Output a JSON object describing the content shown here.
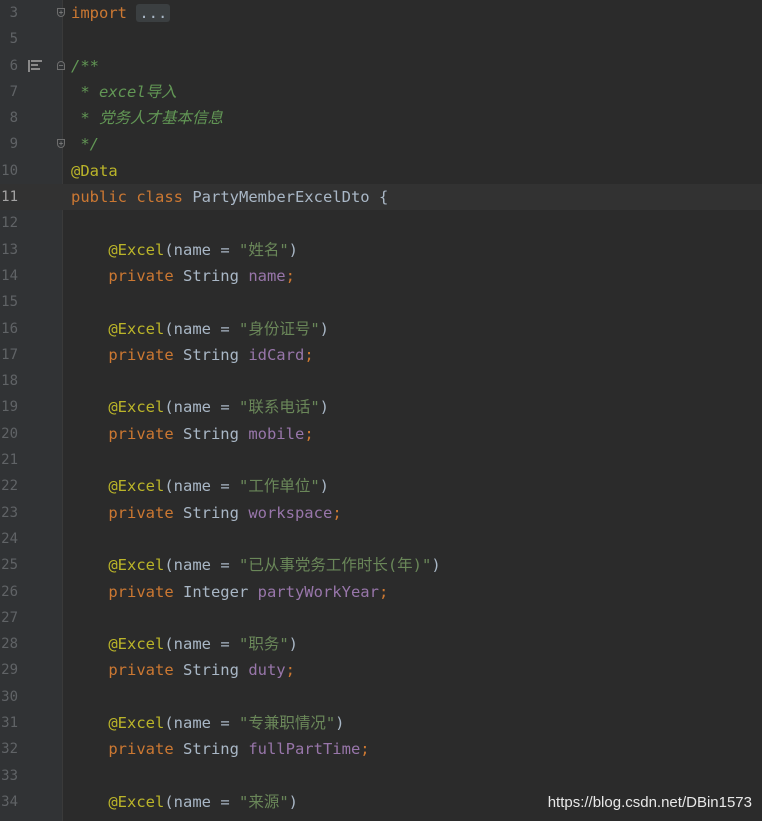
{
  "editor": {
    "lines": [
      {
        "n": "3",
        "tokens": [
          {
            "t": "import ",
            "c": "kw"
          },
          {
            "t": "...",
            "c": "fold"
          }
        ]
      },
      {
        "n": "5",
        "tokens": []
      },
      {
        "n": "6",
        "tokens": [
          {
            "t": "/**",
            "c": "cmt"
          }
        ]
      },
      {
        "n": "7",
        "tokens": [
          {
            "t": " * excel导入",
            "c": "cmt"
          }
        ]
      },
      {
        "n": "8",
        "tokens": [
          {
            "t": " * 党务人才基本信息",
            "c": "cmt"
          }
        ]
      },
      {
        "n": "9",
        "tokens": [
          {
            "t": " */",
            "c": "cmt"
          }
        ]
      },
      {
        "n": "10",
        "tokens": [
          {
            "t": "@Data",
            "c": "ann"
          }
        ]
      },
      {
        "n": "11",
        "tokens": [
          {
            "t": "public class ",
            "c": "kw"
          },
          {
            "t": "PartyMemberExcelDto {",
            "c": ""
          }
        ]
      },
      {
        "n": "12",
        "tokens": []
      },
      {
        "n": "13",
        "tokens": [
          {
            "t": "    @Excel",
            "c": "ann"
          },
          {
            "t": "(name = ",
            "c": ""
          },
          {
            "t": "\"姓名\"",
            "c": "str"
          },
          {
            "t": ")",
            "c": ""
          }
        ]
      },
      {
        "n": "14",
        "tokens": [
          {
            "t": "    private ",
            "c": "kw"
          },
          {
            "t": "String ",
            "c": ""
          },
          {
            "t": "name",
            "c": "fld"
          },
          {
            "t": ";",
            "c": "kw"
          }
        ]
      },
      {
        "n": "15",
        "tokens": []
      },
      {
        "n": "16",
        "tokens": [
          {
            "t": "    @Excel",
            "c": "ann"
          },
          {
            "t": "(name = ",
            "c": ""
          },
          {
            "t": "\"身份证号\"",
            "c": "str"
          },
          {
            "t": ")",
            "c": ""
          }
        ]
      },
      {
        "n": "17",
        "tokens": [
          {
            "t": "    private ",
            "c": "kw"
          },
          {
            "t": "String ",
            "c": ""
          },
          {
            "t": "idCard",
            "c": "fld"
          },
          {
            "t": ";",
            "c": "kw"
          }
        ]
      },
      {
        "n": "18",
        "tokens": []
      },
      {
        "n": "19",
        "tokens": [
          {
            "t": "    @Excel",
            "c": "ann"
          },
          {
            "t": "(name = ",
            "c": ""
          },
          {
            "t": "\"联系电话\"",
            "c": "str"
          },
          {
            "t": ")",
            "c": ""
          }
        ]
      },
      {
        "n": "20",
        "tokens": [
          {
            "t": "    private ",
            "c": "kw"
          },
          {
            "t": "String ",
            "c": ""
          },
          {
            "t": "mobile",
            "c": "fld"
          },
          {
            "t": ";",
            "c": "kw"
          }
        ]
      },
      {
        "n": "21",
        "tokens": []
      },
      {
        "n": "22",
        "tokens": [
          {
            "t": "    @Excel",
            "c": "ann"
          },
          {
            "t": "(name = ",
            "c": ""
          },
          {
            "t": "\"工作单位\"",
            "c": "str"
          },
          {
            "t": ")",
            "c": ""
          }
        ]
      },
      {
        "n": "23",
        "tokens": [
          {
            "t": "    private ",
            "c": "kw"
          },
          {
            "t": "String ",
            "c": ""
          },
          {
            "t": "workspace",
            "c": "fld"
          },
          {
            "t": ";",
            "c": "kw"
          }
        ]
      },
      {
        "n": "24",
        "tokens": []
      },
      {
        "n": "25",
        "tokens": [
          {
            "t": "    @Excel",
            "c": "ann"
          },
          {
            "t": "(name = ",
            "c": ""
          },
          {
            "t": "\"已从事党务工作时长(年)\"",
            "c": "str"
          },
          {
            "t": ")",
            "c": ""
          }
        ]
      },
      {
        "n": "26",
        "tokens": [
          {
            "t": "    private ",
            "c": "kw"
          },
          {
            "t": "Integer ",
            "c": ""
          },
          {
            "t": "partyWorkYear",
            "c": "fld"
          },
          {
            "t": ";",
            "c": "kw"
          }
        ]
      },
      {
        "n": "27",
        "tokens": []
      },
      {
        "n": "28",
        "tokens": [
          {
            "t": "    @Excel",
            "c": "ann"
          },
          {
            "t": "(name = ",
            "c": ""
          },
          {
            "t": "\"职务\"",
            "c": "str"
          },
          {
            "t": ")",
            "c": ""
          }
        ]
      },
      {
        "n": "29",
        "tokens": [
          {
            "t": "    private ",
            "c": "kw"
          },
          {
            "t": "String ",
            "c": ""
          },
          {
            "t": "duty",
            "c": "fld"
          },
          {
            "t": ";",
            "c": "kw"
          }
        ]
      },
      {
        "n": "30",
        "tokens": []
      },
      {
        "n": "31",
        "tokens": [
          {
            "t": "    @Excel",
            "c": "ann"
          },
          {
            "t": "(name = ",
            "c": ""
          },
          {
            "t": "\"专兼职情况\"",
            "c": "str"
          },
          {
            "t": ")",
            "c": ""
          }
        ]
      },
      {
        "n": "32",
        "tokens": [
          {
            "t": "    private ",
            "c": "kw"
          },
          {
            "t": "String ",
            "c": ""
          },
          {
            "t": "fullPartTime",
            "c": "fld"
          },
          {
            "t": ";",
            "c": "kw"
          }
        ]
      },
      {
        "n": "33",
        "tokens": []
      },
      {
        "n": "34",
        "tokens": [
          {
            "t": "    @Excel",
            "c": "ann"
          },
          {
            "t": "(name = ",
            "c": ""
          },
          {
            "t": "\"来源\"",
            "c": "str"
          },
          {
            "t": ")",
            "c": ""
          }
        ]
      }
    ],
    "current_line": "11",
    "fold_markers": {
      "3": "close",
      "6": "open",
      "9": "close"
    },
    "icons": {
      "6": "doc-comment-icon"
    }
  },
  "watermark": "https://blog.csdn.net/DBin1573",
  "colors": {
    "background": "#2b2b2b",
    "gutter": "#313335",
    "keyword": "#cc7832",
    "annotation": "#bbb529",
    "string": "#6a8759",
    "field": "#9876aa",
    "comment": "#629755",
    "text": "#a9b7c6"
  }
}
